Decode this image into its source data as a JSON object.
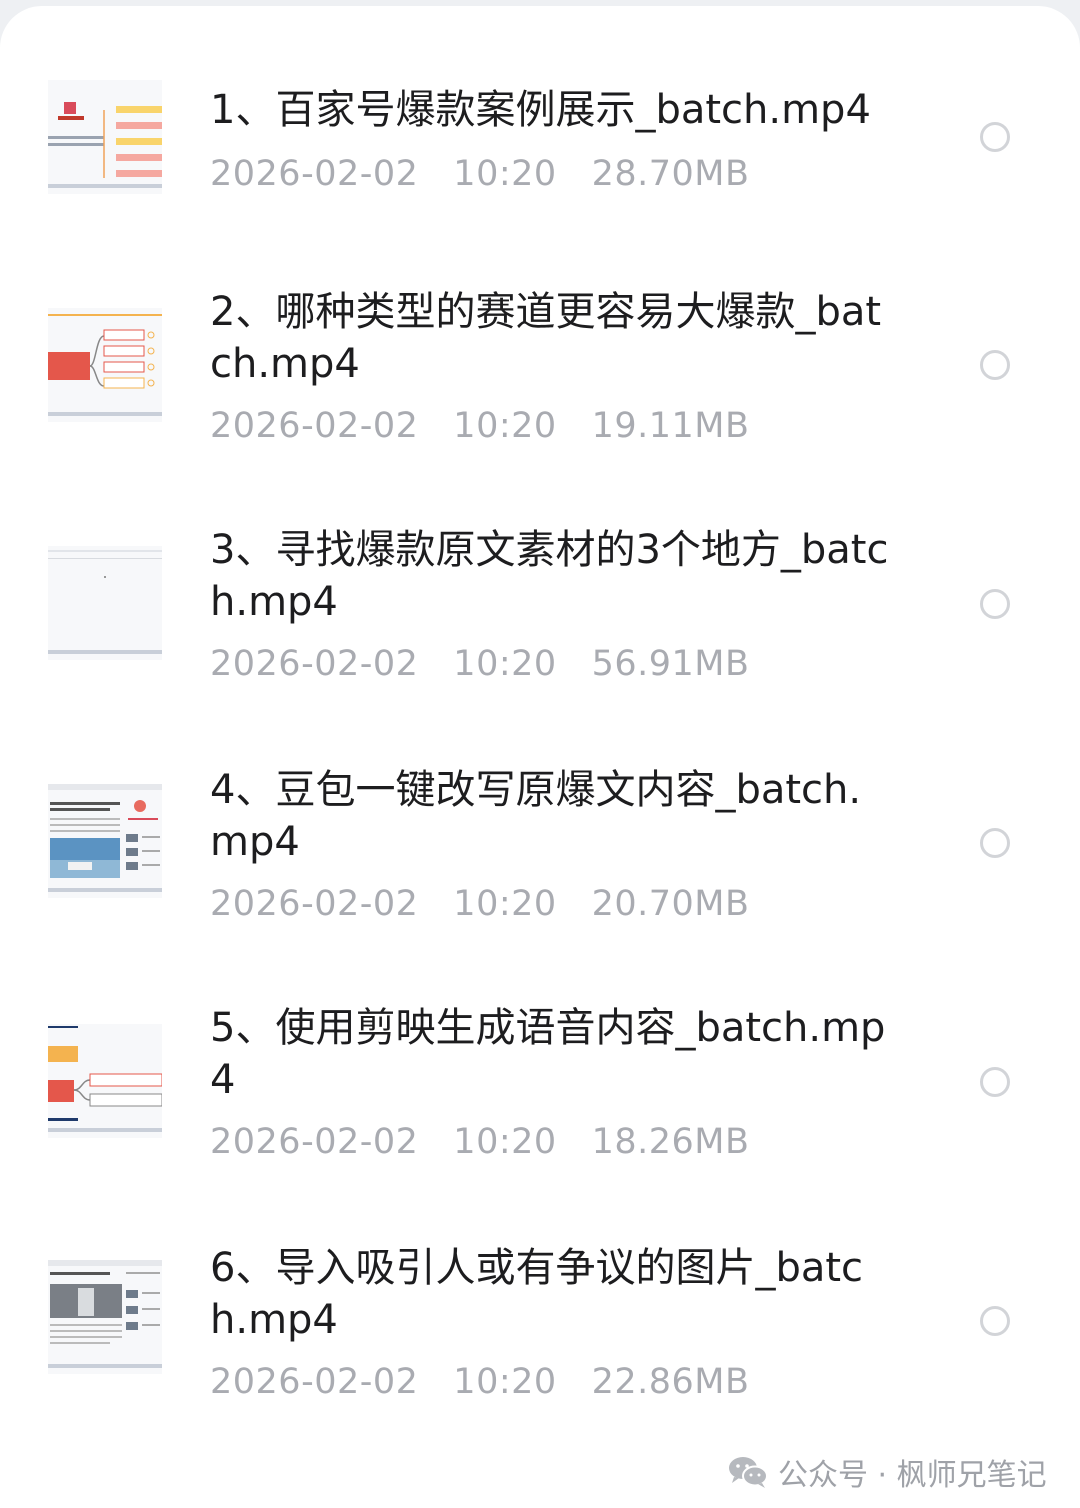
{
  "files": [
    {
      "title": "1、百家号爆款案例展示_batch.mp4",
      "date": "2026-02-02",
      "time": "10:20",
      "size": "28.70MB"
    },
    {
      "title": "2、哪种类型的赛道更容易大爆款_batch.mp4",
      "date": "2026-02-02",
      "time": "10:20",
      "size": "19.11MB"
    },
    {
      "title": "3、寻找爆款原文素材的3个地方_batch.mp4",
      "date": "2026-02-02",
      "time": "10:20",
      "size": "56.91MB"
    },
    {
      "title": "4、豆包一键改写原爆文内容_batch.mp4",
      "date": "2026-02-02",
      "time": "10:20",
      "size": "20.70MB"
    },
    {
      "title": "5、使用剪映生成语音内容_batch.mp4",
      "date": "2026-02-02",
      "time": "10:20",
      "size": "18.26MB"
    },
    {
      "title": "6、导入吸引人或有争议的图片_batch.mp4",
      "date": "2026-02-02",
      "time": "10:20",
      "size": "22.86MB"
    }
  ],
  "watermark": {
    "label": "公众号 · 枫师兄笔记",
    "icon": "wechat-icon"
  }
}
